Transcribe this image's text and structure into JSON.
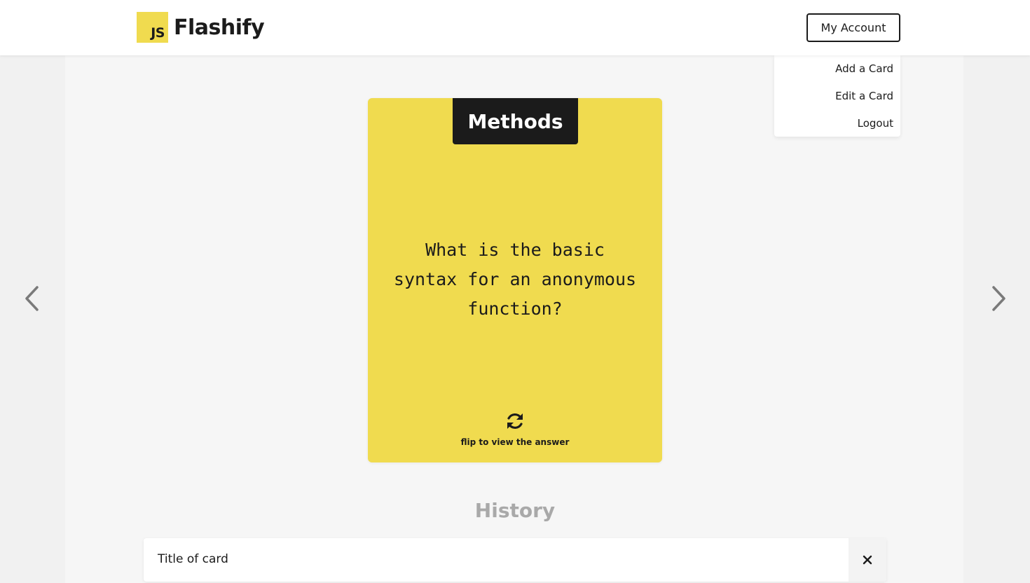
{
  "brand": {
    "logo_text": "JS",
    "name": "Flashify",
    "accent_color": "#f0db4f"
  },
  "header": {
    "account_label": "My Account"
  },
  "account_menu": {
    "items": [
      {
        "label": "Add a Card"
      },
      {
        "label": "Edit a Card"
      },
      {
        "label": "Logout"
      }
    ]
  },
  "card": {
    "category": "Methods",
    "question": "What is the basic syntax for an anonymous function?",
    "flip_hint": "flip to view the answer",
    "flip_icon": "refresh-icon",
    "background_color": "#f0db4f"
  },
  "navigation": {
    "prev_icon": "chevron-left-icon",
    "next_icon": "chevron-right-icon"
  },
  "history": {
    "title": "History",
    "items": [
      {
        "title": "Title of card",
        "remove_icon": "close-icon"
      }
    ]
  }
}
